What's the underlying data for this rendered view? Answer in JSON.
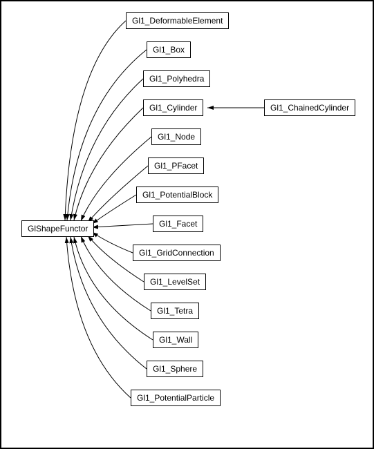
{
  "diagram": {
    "root": {
      "label": "GlShapeFunctor"
    },
    "children": [
      {
        "id": "deformable",
        "label": "Gl1_DeformableElement"
      },
      {
        "id": "box",
        "label": "Gl1_Box"
      },
      {
        "id": "polyhedra",
        "label": "Gl1_Polyhedra"
      },
      {
        "id": "cylinder",
        "label": "Gl1_Cylinder"
      },
      {
        "id": "node",
        "label": "Gl1_Node"
      },
      {
        "id": "pfacet",
        "label": "Gl1_PFacet"
      },
      {
        "id": "potentialblock",
        "label": "Gl1_PotentialBlock"
      },
      {
        "id": "facet",
        "label": "Gl1_Facet"
      },
      {
        "id": "gridconnection",
        "label": "Gl1_GridConnection"
      },
      {
        "id": "levelset",
        "label": "Gl1_LevelSet"
      },
      {
        "id": "tetra",
        "label": "Gl1_Tetra"
      },
      {
        "id": "wall",
        "label": "Gl1_Wall"
      },
      {
        "id": "sphere",
        "label": "Gl1_Sphere"
      },
      {
        "id": "potentialparticle",
        "label": "Gl1_PotentialParticle"
      }
    ],
    "grandchild": {
      "label": "Gl1_ChainedCylinder"
    }
  }
}
